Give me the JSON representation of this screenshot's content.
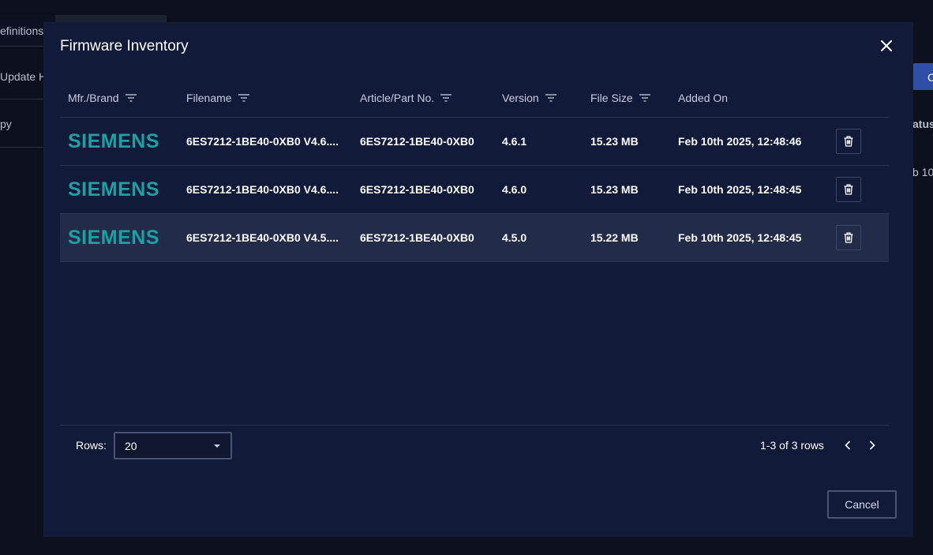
{
  "background": {
    "tab_text": "efinitions",
    "side_text_1": "Update H",
    "side_text_2": "py",
    "right_text_1": "atus",
    "right_text_2": "b 10",
    "right_button_text": "C"
  },
  "modal": {
    "title": "Firmware Inventory",
    "close_icon": "close-icon"
  },
  "table": {
    "columns": [
      {
        "label": "Mfr./Brand",
        "filter": true
      },
      {
        "label": "Filename",
        "filter": true
      },
      {
        "label": "Article/Part No.",
        "filter": true
      },
      {
        "label": "Version",
        "filter": true
      },
      {
        "label": "File Size",
        "filter": true
      },
      {
        "label": "Added On",
        "filter": false
      }
    ],
    "rows": [
      {
        "brand": "SIEMENS",
        "filename": "6ES7212-1BE40-0XB0 V4.6....",
        "part_no": "6ES7212-1BE40-0XB0",
        "version": "4.6.1",
        "size": "15.23 MB",
        "added": "Feb 10th 2025, 12:48:46"
      },
      {
        "brand": "SIEMENS",
        "filename": "6ES7212-1BE40-0XB0 V4.6....",
        "part_no": "6ES7212-1BE40-0XB0",
        "version": "4.6.0",
        "size": "15.23 MB",
        "added": "Feb 10th 2025, 12:48:45"
      },
      {
        "brand": "SIEMENS",
        "filename": "6ES7212-1BE40-0XB0 V4.5....",
        "part_no": "6ES7212-1BE40-0XB0",
        "version": "4.5.0",
        "size": "15.22 MB",
        "added": "Feb 10th 2025, 12:48:45"
      }
    ]
  },
  "pagination": {
    "rows_label": "Rows:",
    "rows_value": "20",
    "info": "1-3 of 3 rows"
  },
  "actions": {
    "cancel_label": "Cancel"
  },
  "colors": {
    "brand": "#1ba1a4",
    "modal_bg": "#111a38",
    "highlight_row": "#222c48"
  }
}
